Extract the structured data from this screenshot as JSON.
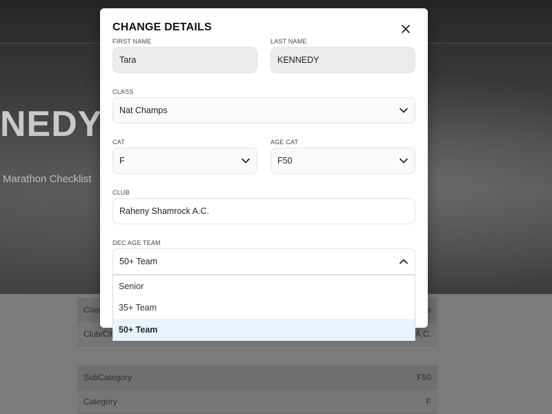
{
  "background": {
    "athlete_name": "NEDY",
    "subtitle": "Marathon Checklist",
    "table_top": [
      {
        "label": "Class",
        "value": "s"
      },
      {
        "label": "Club/City",
        "value": "A.C."
      }
    ],
    "table_bottom": [
      {
        "label": "SubCategory",
        "value": "F50"
      },
      {
        "label": "Category",
        "value": "F"
      }
    ]
  },
  "modal": {
    "title": "CHANGE DETAILS",
    "close_icon": "close-icon",
    "fields": {
      "first_name": {
        "label": "FIRST NAME",
        "value": "Tara"
      },
      "last_name": {
        "label": "LAST NAME",
        "value": "KENNEDY"
      },
      "class": {
        "label": "CLASS",
        "value": "Nat Champs"
      },
      "cat": {
        "label": "CAT",
        "value": "F"
      },
      "age_cat": {
        "label": "AGE CAT",
        "value": "F50"
      },
      "club": {
        "label": "CLUB",
        "value": "Raheny Shamrock A.C."
      },
      "dec_age_team": {
        "label": "DEC AGE TEAM",
        "value": "50+ Team"
      }
    },
    "dropdown_options": [
      "Senior",
      "35+ Team",
      "50+ Team"
    ],
    "selected_option": "50+ Team"
  }
}
